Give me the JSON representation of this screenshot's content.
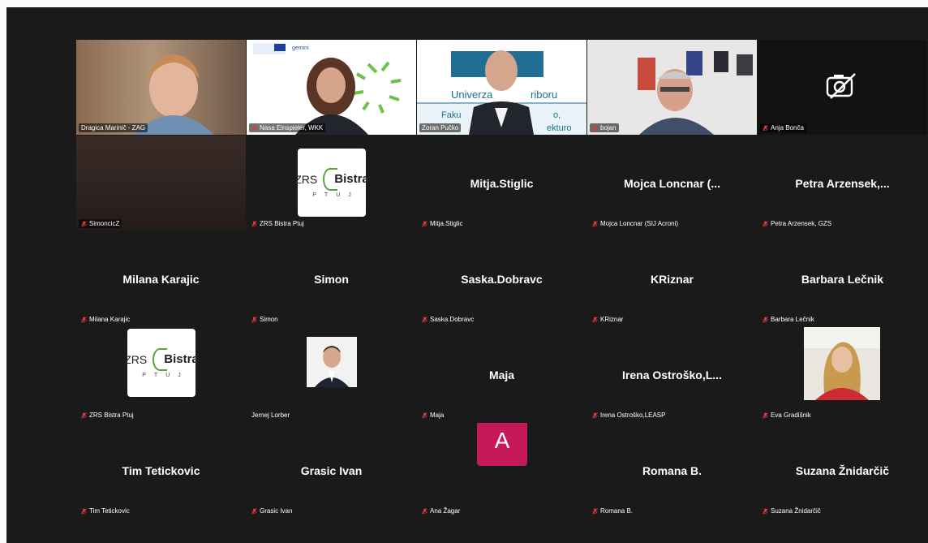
{
  "colors": {
    "background": "#1a1a1a",
    "active_speaker": "#23d959",
    "muted_mic": "#e0393e",
    "avatar_a": "#c5195a",
    "zrs_green": "#58a33d"
  },
  "zrs_logo": {
    "main": "ZRS",
    "brand": "Bistra",
    "sub": "PTUJ"
  },
  "participants": [
    {
      "name": "Dragica Marinič - ZAG",
      "type": "video",
      "muted": false
    },
    {
      "name": "Nasa Einspieler, WKK",
      "type": "video",
      "muted": true
    },
    {
      "name": "Zoran Pučko",
      "type": "video",
      "muted": false,
      "active": true,
      "banner_text_1": "Univerza",
      "banner_text_2": "riboru",
      "banner_text_3": "Faku",
      "banner_text_4": "o,",
      "banner_text_5": "ekturo"
    },
    {
      "name": "bojan",
      "type": "video",
      "muted": true
    },
    {
      "name": "Anja Bonča",
      "type": "video-off",
      "muted": true,
      "icon": "camera-off-icon"
    },
    {
      "name": "SimoncicZ",
      "type": "video",
      "muted": true
    },
    {
      "name": "ZRS Bistra Ptuj",
      "type": "logo",
      "muted": true
    },
    {
      "name": "Mitja.Stiglic",
      "display": "Mitja.Stiglic",
      "type": "name",
      "muted": true
    },
    {
      "name": "Mojca Loncnar (SIJ Acroni)",
      "display": "Mojca Loncnar (...",
      "type": "name",
      "muted": true
    },
    {
      "name": "Petra Arzensek, GZS",
      "display": "Petra Arzensek,...",
      "type": "name",
      "muted": true
    },
    {
      "name": "Milana Karajic",
      "display": "Milana Karajic",
      "type": "name",
      "muted": true
    },
    {
      "name": "Simon",
      "display": "Simon",
      "type": "name",
      "muted": true
    },
    {
      "name": "Saska.Dobravc",
      "display": "Saska.Dobravc",
      "type": "name",
      "muted": true
    },
    {
      "name": "KRiznar",
      "display": "KRiznar",
      "type": "name",
      "muted": true
    },
    {
      "name": "Barbara Lečnik",
      "display": "Barbara Lečnik",
      "type": "name",
      "muted": true
    },
    {
      "name": "ZRS Bistra Ptuj",
      "type": "logo",
      "muted": true
    },
    {
      "name": "Jernej Lorber",
      "type": "photo",
      "muted": false
    },
    {
      "name": "Maja",
      "display": "Maja",
      "type": "name",
      "muted": true
    },
    {
      "name": "Irena Ostroško,LEASP",
      "display": "Irena Ostroško,L...",
      "type": "name",
      "muted": true
    },
    {
      "name": "Eva Gradišnik",
      "type": "photo",
      "muted": true
    },
    {
      "name": "Tim Tetickovic",
      "display": "Tim Tetickovic",
      "type": "name",
      "muted": true
    },
    {
      "name": "Grasic Ivan",
      "display": "Grasic Ivan",
      "type": "name",
      "muted": true
    },
    {
      "name": "Ana Žagar",
      "type": "avatar",
      "letter": "A",
      "muted": true
    },
    {
      "name": "Romana B.",
      "display": "Romana B.",
      "type": "name",
      "muted": true
    },
    {
      "name": "Suzana Žnidarčič",
      "display": "Suzana Žnidarčič",
      "type": "name",
      "muted": true
    }
  ]
}
